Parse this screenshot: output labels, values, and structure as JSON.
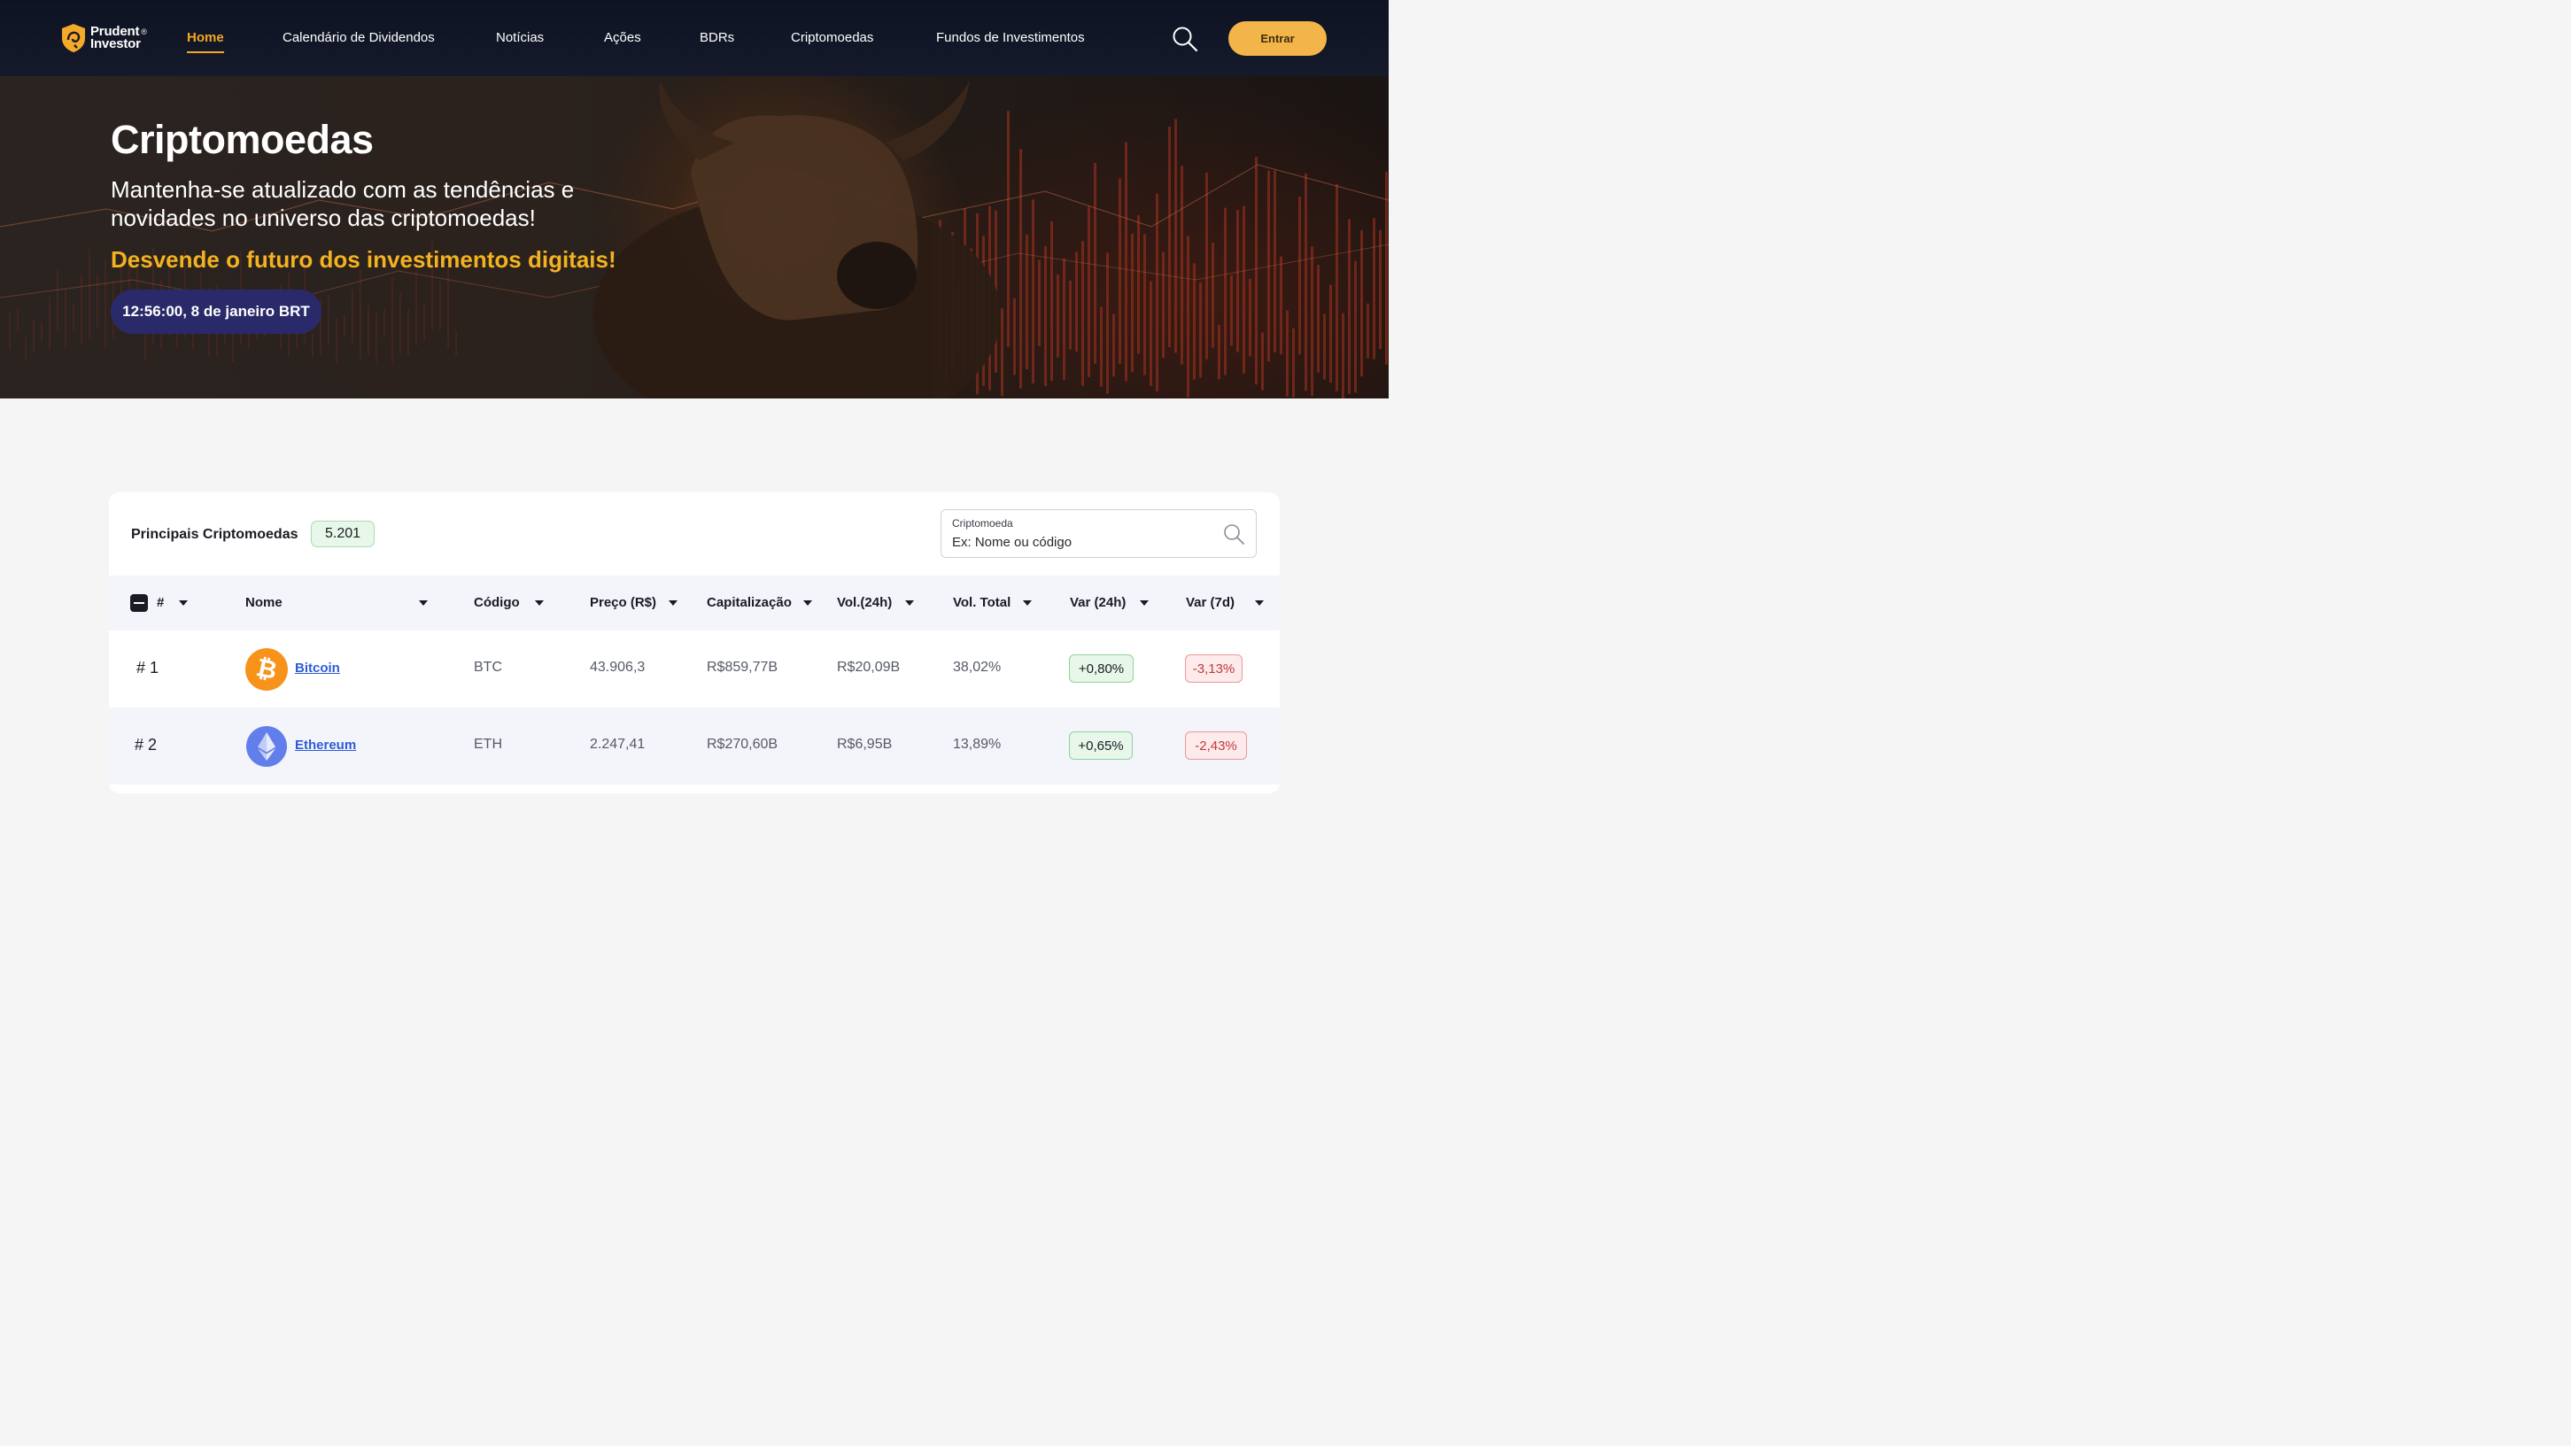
{
  "nav": {
    "logo_line1": "Prudent",
    "logo_line2": "Investor",
    "logo_reg": "®",
    "links": [
      "Home",
      "Calendário de Dividendos",
      "Notícias",
      "Ações",
      "BDRs",
      "Criptomoedas",
      "Fundos de Investimentos"
    ],
    "login_label": "Entrar"
  },
  "hero": {
    "title": "Criptomoedas",
    "subtitle": "Mantenha-se atualizado com as tendências e novidades no universo das criptomoedas!",
    "tagline": "Desvende o futuro dos investimentos digitais!",
    "clock": "12:56:00, 8 de janeiro BRT"
  },
  "table_card": {
    "title": "Principais Criptomoedas",
    "count": "5.201",
    "search_label": "Criptomoeda",
    "search_placeholder": "Ex: Nome ou código",
    "columns": [
      "#",
      "Nome",
      "Código",
      "Preço (R$)",
      "Capitalização",
      "Vol.(24h)",
      "Vol. Total",
      "Var (24h)",
      "Var (7d)"
    ],
    "rows": [
      {
        "rank": "# 1",
        "name": "Bitcoin",
        "code": "BTC",
        "price": "43.906,3",
        "cap": "R$859,77B",
        "vol24": "R$20,09B",
        "voltotal": "38,02%",
        "var24": "+0,80%",
        "var7d": "-3,13%"
      },
      {
        "rank": "# 2",
        "name": "Ethereum",
        "code": "ETH",
        "price": "2.247,41",
        "cap": "R$270,60B",
        "vol24": "R$6,95B",
        "voltotal": "13,89%",
        "var24": "+0,65%",
        "var7d": "-2,43%"
      }
    ]
  },
  "colors": {
    "accent": "#f3b54a",
    "nav_bg": "#0e1323",
    "clock_bg": "#2a2a6a",
    "tagline": "#f3b21f",
    "positive_bg": "#e7f7e9",
    "negative_bg": "#fdeaea",
    "link": "#2d5bd8"
  },
  "icons": [
    "logo-mark-icon",
    "search-icon",
    "sort-caret-icon",
    "bitcoin-icon",
    "ethereum-icon"
  ]
}
